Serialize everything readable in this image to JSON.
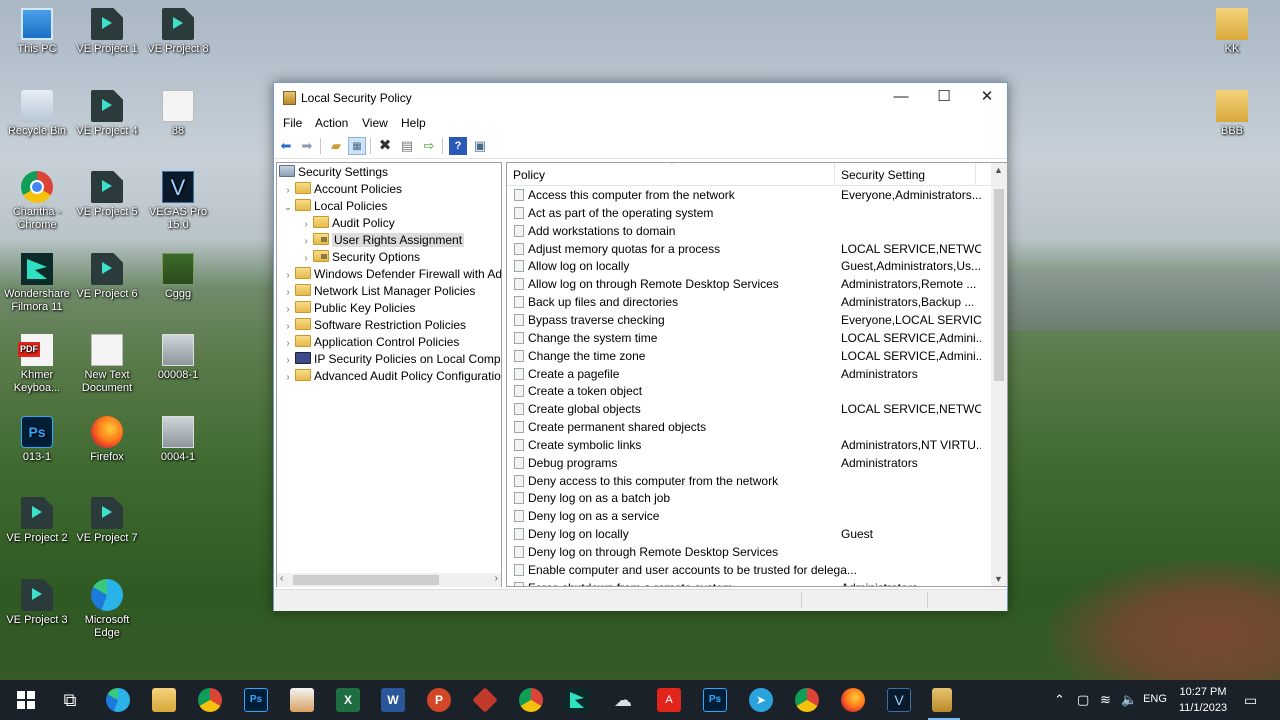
{
  "desktop": {
    "icons": [
      {
        "label": "This PC",
        "icon": "computer-icon"
      },
      {
        "label": "VE Project 1",
        "icon": "ve-project-icon"
      },
      {
        "label": "VE Project 8",
        "icon": "ve-project-icon"
      },
      {
        "label": "Recycle Bin",
        "icon": "recycle-bin-icon"
      },
      {
        "label": "VE Project 4",
        "icon": "ve-project-icon"
      },
      {
        "label": "88",
        "icon": "text-document-icon"
      },
      {
        "label": "Chantha - Chrome",
        "icon": "chrome-icon"
      },
      {
        "label": "VE Project 5",
        "icon": "ve-project-icon"
      },
      {
        "label": "VEGAS Pro 15.0",
        "icon": "vegas-icon"
      },
      {
        "label": "Wondershare Filmora 11",
        "icon": "filmora-icon"
      },
      {
        "label": "VE Project 6",
        "icon": "ve-project-icon"
      },
      {
        "label": "Cggg",
        "icon": "image-icon"
      },
      {
        "label": "Khmer Keyboa...",
        "icon": "pdf-icon"
      },
      {
        "label": "New Text Document",
        "icon": "text-document-icon"
      },
      {
        "label": "00008-1",
        "icon": "image-icon"
      },
      {
        "label": "013-1",
        "icon": "photoshop-file-icon"
      },
      {
        "label": "Firefox",
        "icon": "firefox-icon"
      },
      {
        "label": "0004-1",
        "icon": "image-icon"
      },
      {
        "label": "VE Project 2",
        "icon": "ve-project-icon"
      },
      {
        "label": "VE Project 7",
        "icon": "ve-project-icon"
      },
      {
        "label": "VE Project 3",
        "icon": "ve-project-icon"
      },
      {
        "label": "Microsoft Edge",
        "icon": "edge-icon"
      },
      {
        "label": "KK",
        "icon": "folder-icon"
      },
      {
        "label": "BBB",
        "icon": "folder-icon"
      }
    ]
  },
  "window": {
    "title": "Local Security Policy",
    "controls": {
      "minimize": "—",
      "maximize": "☐",
      "close": "✕"
    },
    "menu": [
      "File",
      "Action",
      "View",
      "Help"
    ],
    "toolbar": [
      "back-icon",
      "forward-icon",
      "up-folder-icon",
      "show-hide-tree-icon",
      "delete-icon",
      "properties-icon",
      "export-list-icon",
      "help-icon",
      "console-icon"
    ],
    "tree": [
      {
        "label": "Security Settings",
        "level": 0,
        "expanded": true,
        "icon": "root"
      },
      {
        "label": "Account Policies",
        "level": 1,
        "expanded": false,
        "icon": "folder"
      },
      {
        "label": "Local Policies",
        "level": 1,
        "expanded": true,
        "icon": "folder"
      },
      {
        "label": "Audit Policy",
        "level": 2,
        "expanded": false,
        "icon": "folder"
      },
      {
        "label": "User Rights Assignment",
        "level": 2,
        "expanded": false,
        "icon": "lock",
        "selected": true
      },
      {
        "label": "Security Options",
        "level": 2,
        "expanded": false,
        "icon": "lock"
      },
      {
        "label": "Windows Defender Firewall with Adva",
        "level": 1,
        "expanded": false,
        "icon": "folder"
      },
      {
        "label": "Network List Manager Policies",
        "level": 1,
        "expanded": false,
        "icon": "folder"
      },
      {
        "label": "Public Key Policies",
        "level": 1,
        "expanded": false,
        "icon": "folder"
      },
      {
        "label": "Software Restriction Policies",
        "level": 1,
        "expanded": false,
        "icon": "folder"
      },
      {
        "label": "Application Control Policies",
        "level": 1,
        "expanded": false,
        "icon": "folder"
      },
      {
        "label": "IP Security Policies on Local Compute",
        "level": 1,
        "expanded": false,
        "icon": "ip"
      },
      {
        "label": "Advanced Audit Policy Configuration",
        "level": 1,
        "expanded": false,
        "icon": "folder"
      }
    ],
    "list": {
      "columns": [
        "Policy",
        "Security Setting"
      ],
      "rows": [
        {
          "policy": "Access this computer from the network",
          "setting": "Everyone,Administrators..."
        },
        {
          "policy": "Act as part of the operating system",
          "setting": ""
        },
        {
          "policy": "Add workstations to domain",
          "setting": ""
        },
        {
          "policy": "Adjust memory quotas for a process",
          "setting": "LOCAL SERVICE,NETWO..."
        },
        {
          "policy": "Allow log on locally",
          "setting": "Guest,Administrators,Us..."
        },
        {
          "policy": "Allow log on through Remote Desktop Services",
          "setting": "Administrators,Remote ..."
        },
        {
          "policy": "Back up files and directories",
          "setting": "Administrators,Backup ..."
        },
        {
          "policy": "Bypass traverse checking",
          "setting": "Everyone,LOCAL SERVIC..."
        },
        {
          "policy": "Change the system time",
          "setting": "LOCAL SERVICE,Admini..."
        },
        {
          "policy": "Change the time zone",
          "setting": "LOCAL SERVICE,Admini..."
        },
        {
          "policy": "Create a pagefile",
          "setting": "Administrators"
        },
        {
          "policy": "Create a token object",
          "setting": ""
        },
        {
          "policy": "Create global objects",
          "setting": "LOCAL SERVICE,NETWO..."
        },
        {
          "policy": "Create permanent shared objects",
          "setting": ""
        },
        {
          "policy": "Create symbolic links",
          "setting": "Administrators,NT VIRTU..."
        },
        {
          "policy": "Debug programs",
          "setting": "Administrators"
        },
        {
          "policy": "Deny access to this computer from the network",
          "setting": ""
        },
        {
          "policy": "Deny log on as a batch job",
          "setting": ""
        },
        {
          "policy": "Deny log on as a service",
          "setting": ""
        },
        {
          "policy": "Deny log on locally",
          "setting": "Guest"
        },
        {
          "policy": "Deny log on through Remote Desktop Services",
          "setting": ""
        },
        {
          "policy": "Enable computer and user accounts to be trusted for delega...",
          "setting": ""
        },
        {
          "policy": "Force shutdown from a remote system",
          "setting": "Administrators"
        }
      ]
    }
  },
  "taskbar": {
    "apps": [
      "start-icon",
      "task-view-icon",
      "edge-icon",
      "file-explorer-icon",
      "chrome-icon",
      "photoshop-icon",
      "photo-app-icon",
      "excel-icon",
      "word-icon",
      "powerpoint-icon",
      "app-icon",
      "chrome-icon",
      "filmora-icon",
      "cloud-app-icon",
      "acrobat-icon",
      "photoshop-icon",
      "telegram-icon",
      "chrome-icon",
      "firefox-icon",
      "vegas-icon",
      "local-security-policy-icon"
    ],
    "language": "ENG",
    "time": "10:27 PM",
    "date": "11/1/2023"
  }
}
